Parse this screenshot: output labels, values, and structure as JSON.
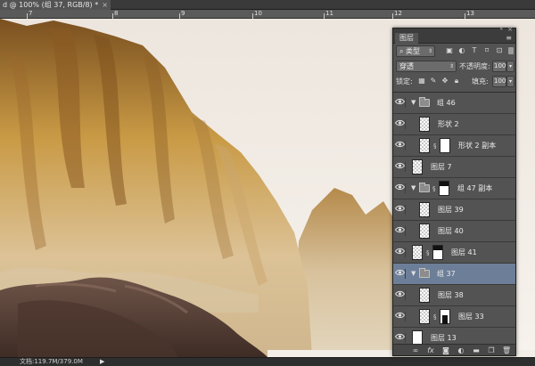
{
  "document_tab": {
    "title": "d @ 100% (组 37, RGB/8) *",
    "close_glyph": "×"
  },
  "ruler": {
    "labels": [
      "7",
      "8",
      "9",
      "10",
      "11",
      "12",
      "13"
    ]
  },
  "status_bar": {
    "text": "文档:119.7M/379.0M",
    "arrow": "▶"
  },
  "layers_panel": {
    "title": "图层",
    "collapse_glyph": "«",
    "close_glyph": "×",
    "menu_glyph": "≡",
    "filter": {
      "label": "类型",
      "icon": "search-icon"
    },
    "blend_mode": "穿透",
    "opacity_label": "不透明度:",
    "opacity_value": "100%",
    "lock_label": "锁定:",
    "fill_label": "填充:",
    "fill_value": "100%",
    "layers": [
      {
        "name": "组 46",
        "kind": "group",
        "indent": 0,
        "expanded": true
      },
      {
        "name": "形状 2",
        "kind": "layer",
        "indent": 1,
        "thumb": "checker"
      },
      {
        "name": "形状 2 副本",
        "kind": "layer",
        "indent": 1,
        "thumb": "checker",
        "mask": "white"
      },
      {
        "name": "图层 7",
        "kind": "layer",
        "indent": 0,
        "thumb": "checker"
      },
      {
        "name": "组 47 副本",
        "kind": "group",
        "indent": 0,
        "expanded": true,
        "mask": "mask-rev"
      },
      {
        "name": "图层 39",
        "kind": "layer",
        "indent": 1,
        "thumb": "checker"
      },
      {
        "name": "图层 40",
        "kind": "layer",
        "indent": 1,
        "thumb": "checker"
      },
      {
        "name": "图层 41",
        "kind": "layer",
        "indent": 0,
        "thumb": "checker",
        "mask": "mask-rev"
      },
      {
        "name": "组 37",
        "kind": "group",
        "indent": 0,
        "expanded": true,
        "selected": true
      },
      {
        "name": "图层 38",
        "kind": "layer",
        "indent": 1,
        "thumb": "checker"
      },
      {
        "name": "图层 33",
        "kind": "layer",
        "indent": 1,
        "thumb": "checker",
        "mask": "figure"
      },
      {
        "name": "图层 13",
        "kind": "layer",
        "indent": 0,
        "thumb": "white"
      }
    ],
    "footer_buttons": [
      "link-icon",
      "fx-icon",
      "add-mask-icon",
      "adjustment-layer-icon",
      "new-group-icon",
      "new-layer-icon",
      "trash-icon"
    ],
    "footer_glyphs": {
      "link": "∞",
      "fx": "fx"
    },
    "colors": {
      "panel_bg": "#535353",
      "selected_row": "#6d7f98"
    }
  }
}
